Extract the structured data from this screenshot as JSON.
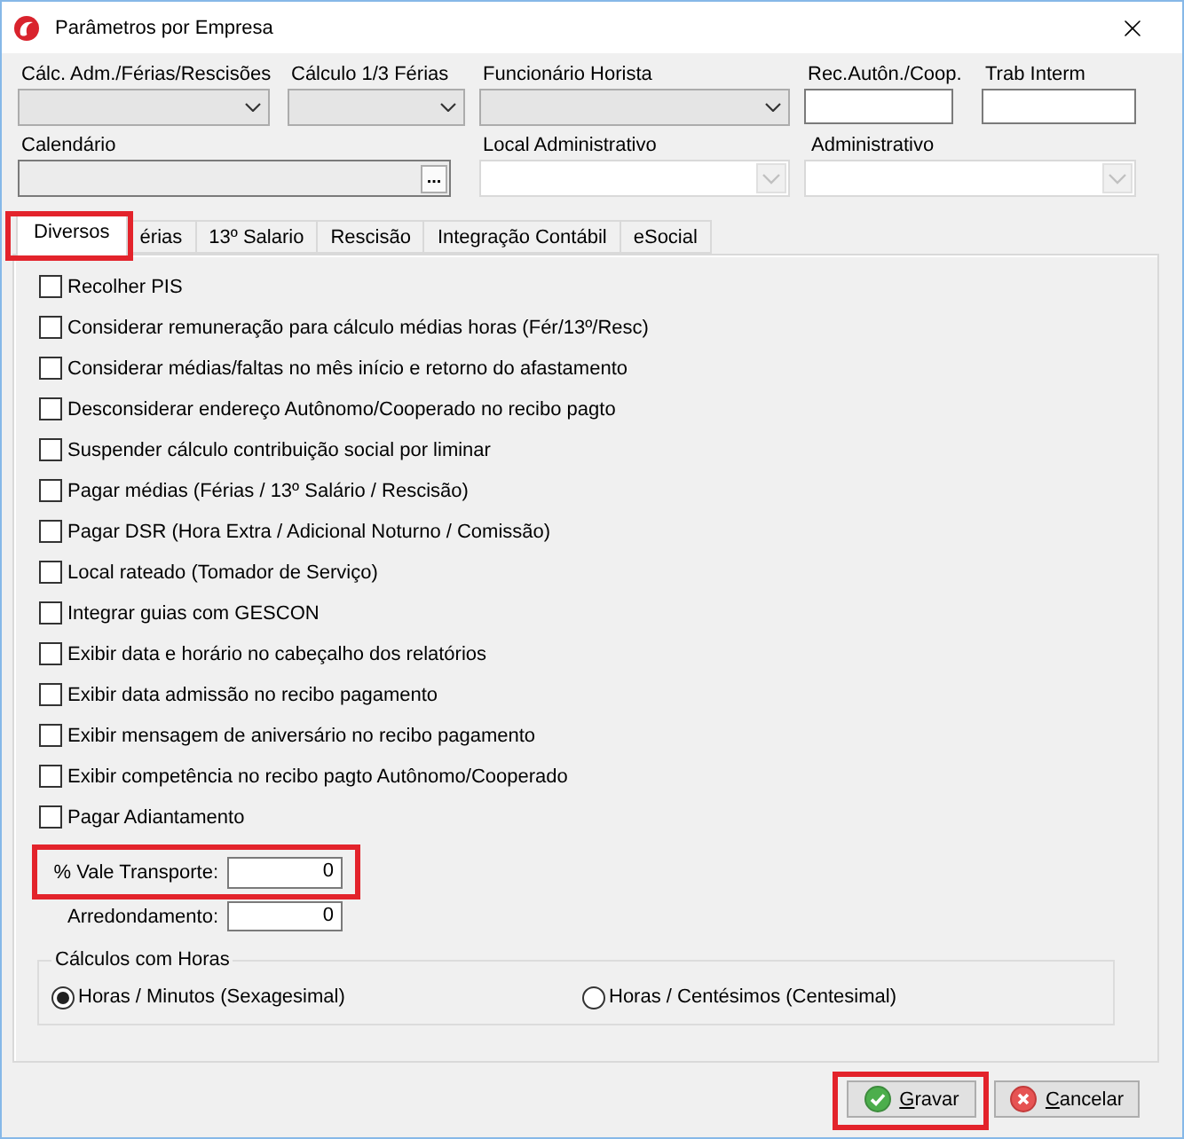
{
  "window": {
    "title": "Parâmetros por Empresa"
  },
  "top_fields": [
    [
      {
        "label": "Cálc. Adm./Férias/Rescisões",
        "kind": "dropdown",
        "disabled": false
      },
      {
        "label": "Cálculo 1/3 Férias",
        "kind": "dropdown",
        "disabled": false
      },
      {
        "label": "Funcionário Horista",
        "kind": "dropdown",
        "disabled": false
      },
      {
        "label": "Rec.Autôn./Coop.",
        "kind": "text"
      },
      {
        "label": "Trab Interm",
        "kind": "text"
      }
    ],
    [
      {
        "label": "Calendário",
        "kind": "lookup",
        "button": "..."
      },
      {
        "label": "Local Administrativo",
        "kind": "dropdown",
        "disabled": true
      },
      {
        "label": "Administrativo",
        "kind": "dropdown",
        "disabled": true
      }
    ]
  ],
  "tabs": [
    {
      "label": "Diversos",
      "selected": true,
      "highlighted": true
    },
    {
      "label": "érias",
      "selected": false,
      "highlighted": false
    },
    {
      "label": "13º Salario",
      "selected": false,
      "highlighted": false
    },
    {
      "label": "Rescisão",
      "selected": false,
      "highlighted": false
    },
    {
      "label": "Integração Contábil",
      "selected": false,
      "highlighted": false
    },
    {
      "label": "eSocial",
      "selected": false,
      "highlighted": false
    }
  ],
  "options": [
    {
      "label": "Recolher PIS",
      "checked": false
    },
    {
      "label": "Considerar remuneração para cálculo médias horas (Fér/13º/Resc)",
      "checked": false
    },
    {
      "label": "Considerar médias/faltas no mês início e retorno do afastamento",
      "checked": false
    },
    {
      "label": "Desconsiderar endereço Autônomo/Cooperado no recibo pagto",
      "checked": false
    },
    {
      "label": "Suspender cálculo contribuição social por liminar",
      "checked": false
    },
    {
      "label": "Pagar médias (Férias / 13º Salário / Rescisão)",
      "checked": false
    },
    {
      "label": "Pagar DSR (Hora Extra / Adicional Noturno / Comissão)",
      "checked": false
    },
    {
      "label": "Local rateado (Tomador de Serviço)",
      "checked": false
    },
    {
      "label": "Integrar guias com GESCON",
      "checked": false
    },
    {
      "label": "Exibir data e horário no cabeçalho dos relatórios",
      "checked": false
    },
    {
      "label": "Exibir data admissão no recibo pagamento",
      "checked": false
    },
    {
      "label": "Exibir mensagem de aniversário no recibo pagamento",
      "checked": false
    },
    {
      "label": "Exibir competência no recibo pagto Autônomo/Cooperado",
      "checked": false
    },
    {
      "label": "Pagar Adiantamento",
      "checked": false
    }
  ],
  "number_fields": [
    {
      "label": "% Vale Transporte:",
      "value": "0",
      "highlighted": true
    },
    {
      "label": "Arredondamento:",
      "value": "0",
      "highlighted": false
    }
  ],
  "hours_group": {
    "title": "Cálculos com Horas",
    "options": [
      {
        "label": "Horas / Minutos (Sexagesimal)",
        "selected": true
      },
      {
        "label": "Horas / Centésimos (Centesimal)",
        "selected": false
      }
    ]
  },
  "buttons": [
    {
      "label": "Gravar",
      "kind": "save",
      "mnemonic_underlined": true,
      "highlighted": true
    },
    {
      "label": "Cancelar",
      "kind": "cancel",
      "mnemonic_underlined": true,
      "highlighted": false
    }
  ]
}
